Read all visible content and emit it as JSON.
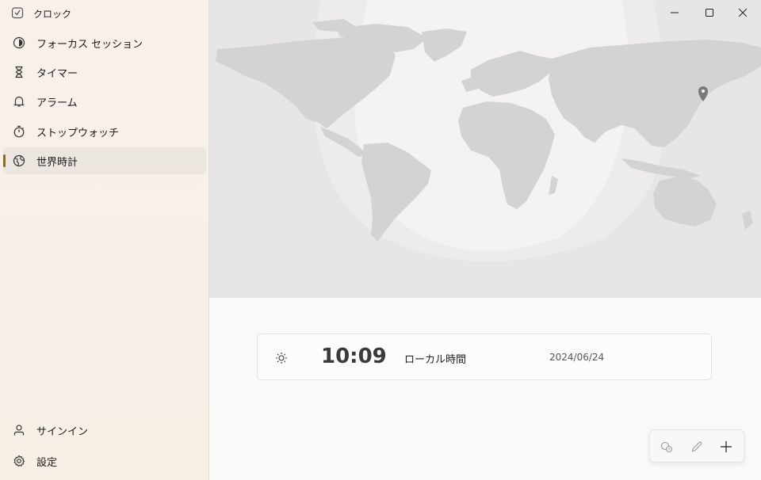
{
  "app": {
    "title": "クロック",
    "icon": "clock-app-icon"
  },
  "sidebar": {
    "items": [
      {
        "label": "フォーカス セッション",
        "icon": "focus-icon"
      },
      {
        "label": "タイマー",
        "icon": "hourglass-icon"
      },
      {
        "label": "アラーム",
        "icon": "bell-icon"
      },
      {
        "label": "ストップウォッチ",
        "icon": "stopwatch-icon"
      },
      {
        "label": "世界時計",
        "icon": "globe-icon",
        "active": true
      }
    ],
    "footer": [
      {
        "label": "サインイン",
        "icon": "person-icon"
      },
      {
        "label": "設定",
        "icon": "gear-icon"
      }
    ]
  },
  "window_controls": [
    "minimize-icon",
    "maximize-icon",
    "close-icon"
  ],
  "world_clock": {
    "entries": [
      {
        "time": "10:09",
        "label": "ローカル時間",
        "date": "2024/06/24",
        "icon": "sun-icon"
      }
    ]
  },
  "actions": [
    "compare-icon",
    "edit-icon",
    "add-icon"
  ],
  "colors": {
    "accent": "#8c6a28",
    "map_land": "#d4d4d3",
    "map_night": "#e9e8e6"
  }
}
